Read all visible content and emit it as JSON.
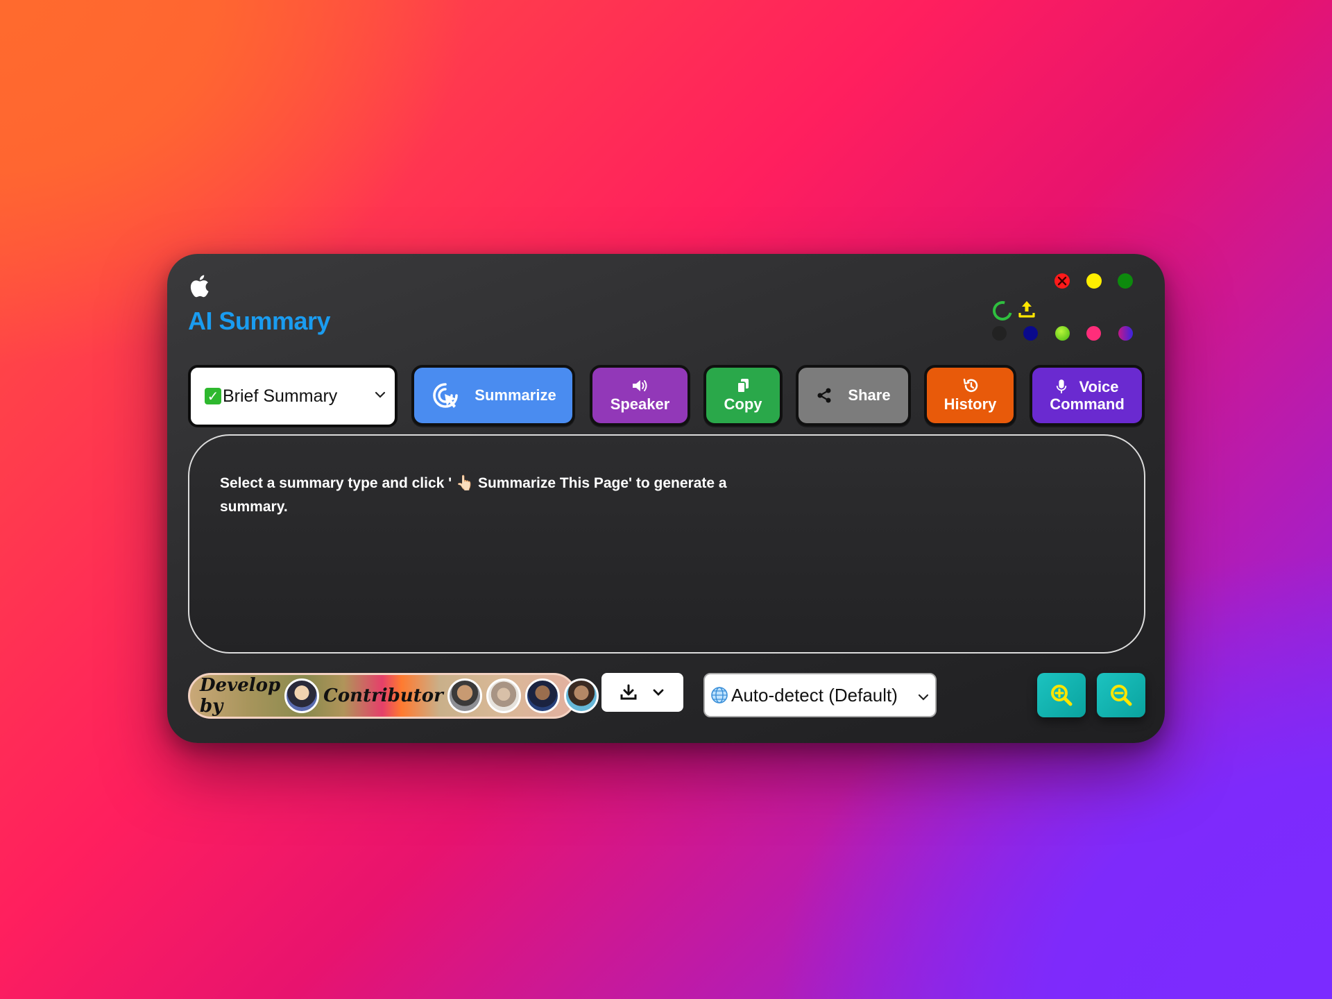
{
  "app": {
    "title": "AI Summary"
  },
  "toolbar": {
    "summary_type_selected": "Brief Summary",
    "summarize_label": "Summarize",
    "speaker_label": "Speaker",
    "copy_label": "Copy",
    "share_label": "Share",
    "history_label": "History",
    "voice_label_1": "Voice",
    "voice_label_2": "Command"
  },
  "content": {
    "message": "Select a summary type and click ' 👆🏻 Summarize This Page' to generate a summary."
  },
  "credits": {
    "develop_label": "Develop by",
    "contributor_label": "Contributor"
  },
  "language": {
    "selected": "Auto-detect (Default)"
  },
  "theme_swatches": [
    "#222222",
    "#0a0a8c",
    "#7ad62a",
    "#ff2d7a",
    "#7a20c8"
  ],
  "colors": {
    "title": "#1a9cf0",
    "summarize": "#4a8cf0",
    "speaker": "#9238b8",
    "copy": "#2aa84a",
    "share": "#7c7c7c",
    "history": "#e85a0a",
    "voice": "#6a2ad0",
    "zoom": "#12b3b0"
  }
}
